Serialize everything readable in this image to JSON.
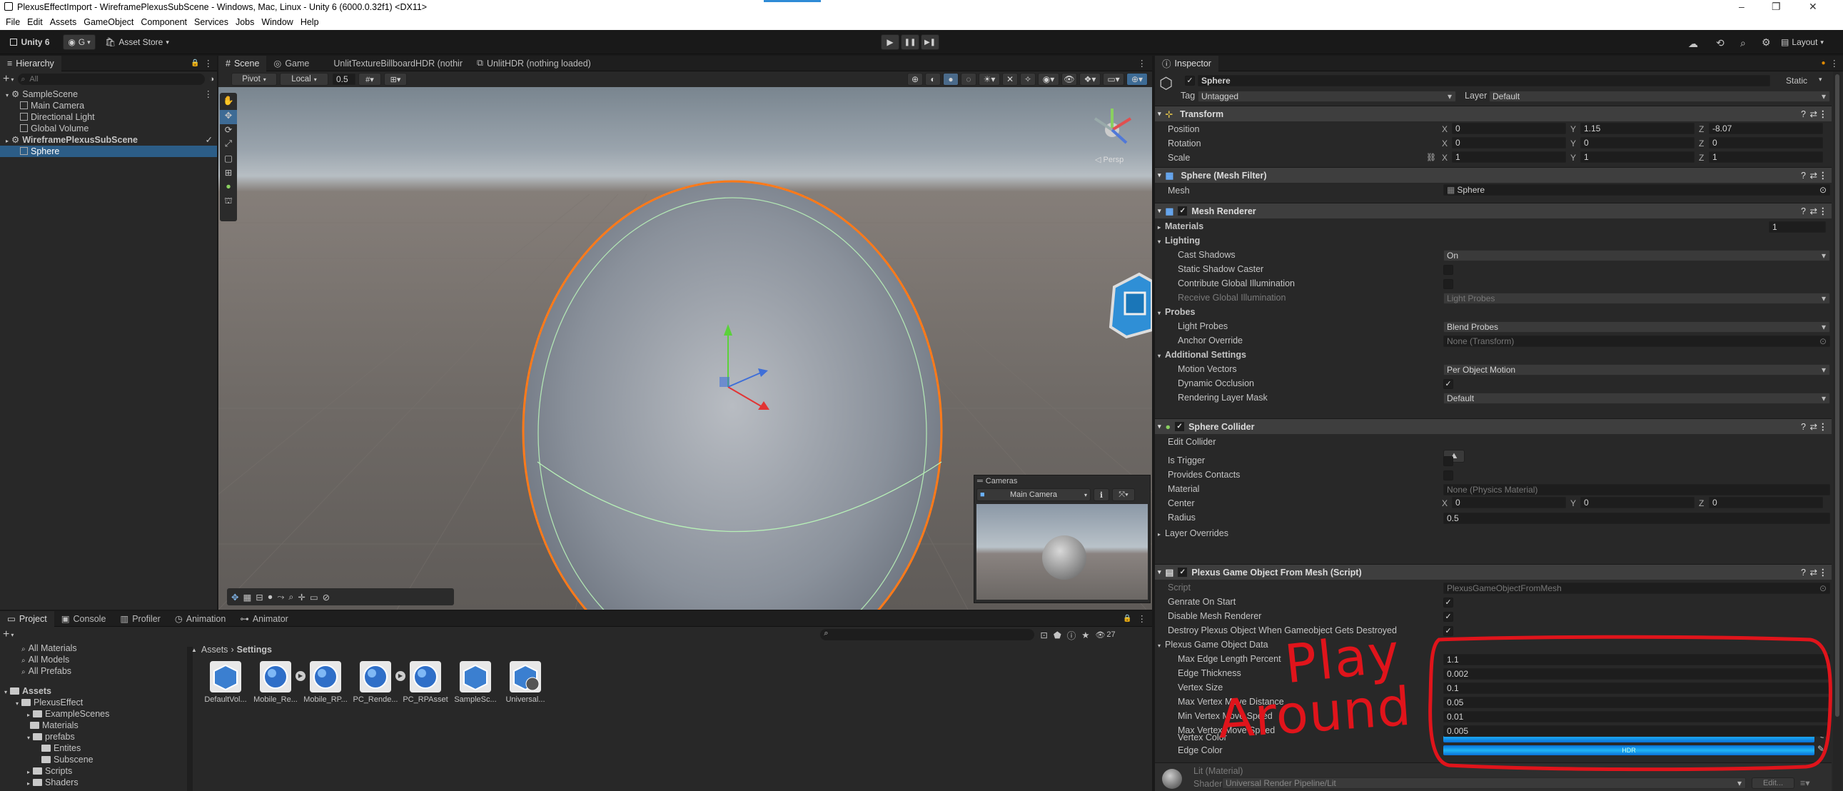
{
  "window": {
    "title": "PlexusEffectImport - WireframePlexusSubScene - Windows, Mac, Linux - Unity 6 (6000.0.32f1) <DX11>",
    "minimize": "–",
    "maximize": "❐",
    "close": "✕"
  },
  "menu": [
    "File",
    "Edit",
    "Assets",
    "GameObject",
    "Component",
    "Services",
    "Jobs",
    "Window",
    "Help"
  ],
  "toolbar": {
    "unity": "Unity 6",
    "account": "G",
    "store": "Asset Store",
    "layout": "Layout"
  },
  "hierarchy": {
    "tab": "Hierarchy",
    "search_placeholder": "All",
    "items": [
      {
        "label": "SampleScene",
        "depth": 0,
        "kind": "scene"
      },
      {
        "label": "Main Camera",
        "depth": 1,
        "kind": "obj"
      },
      {
        "label": "Directional Light",
        "depth": 1,
        "kind": "obj"
      },
      {
        "label": "Global Volume",
        "depth": 1,
        "kind": "obj"
      },
      {
        "label": "WireframePlexusSubScene",
        "depth": 0,
        "kind": "scene",
        "bold": true
      },
      {
        "label": "Sphere",
        "depth": 1,
        "kind": "obj",
        "selected": true
      }
    ]
  },
  "scene": {
    "tabs": [
      "Scene",
      "Game",
      "UnlitTextureBillboardHDR (nothir",
      "UnlitHDR (nothing loaded)"
    ],
    "pivot": "Pivot",
    "local": "Local",
    "snap": "0.5",
    "persp": "◁ Persp",
    "cameras": {
      "title": "Cameras",
      "camera": "Main Camera"
    }
  },
  "project": {
    "tabs": [
      "Project",
      "Console",
      "Profiler",
      "Animation",
      "Animator"
    ],
    "count": "27",
    "favorites": [
      "All Materials",
      "All Models",
      "All Prefabs"
    ],
    "tree": [
      {
        "label": "Assets",
        "depth": 0,
        "bold": true
      },
      {
        "label": "PlexusEffect",
        "depth": 1
      },
      {
        "label": "ExampleScenes",
        "depth": 2
      },
      {
        "label": "Materials",
        "depth": 2
      },
      {
        "label": "prefabs",
        "depth": 2
      },
      {
        "label": "Entites",
        "depth": 3
      },
      {
        "label": "Subscene",
        "depth": 3
      },
      {
        "label": "Scripts",
        "depth": 2
      },
      {
        "label": "Shaders",
        "depth": 2
      }
    ],
    "breadcrumb": [
      "Assets",
      "Settings"
    ],
    "assets": [
      "DefaultVol...",
      "Mobile_Re...",
      "Mobile_RP...",
      "PC_Rende...",
      "PC_RPAsset",
      "SampleSc...",
      "Universal..."
    ]
  },
  "inspector": {
    "tab": "Inspector",
    "name": "Sphere",
    "static": "Static",
    "tag_label": "Tag",
    "tag": "Untagged",
    "layer_label": "Layer",
    "layer": "Default",
    "transform": {
      "title": "Transform",
      "position": [
        "0",
        "1.15",
        "-8.07"
      ],
      "rotation": [
        "0",
        "0",
        "0"
      ],
      "scale": [
        "1",
        "1",
        "1"
      ],
      "labels": [
        "Position",
        "Rotation",
        "Scale"
      ]
    },
    "meshfilter": {
      "title": "Sphere (Mesh Filter)",
      "mesh_label": "Mesh",
      "mesh": "Sphere"
    },
    "meshrenderer": {
      "title": "Mesh Renderer",
      "materials": "Materials",
      "materials_count": "1",
      "lighting": "Lighting",
      "cast_shadows_label": "Cast Shadows",
      "cast_shadows": "On",
      "static_caster": "Static Shadow Caster",
      "contrib_gi": "Contribute Global Illumination",
      "receive_gi_label": "Receive Global Illumination",
      "receive_gi": "Light Probes",
      "probes": "Probes",
      "light_probes_label": "Light Probes",
      "light_probes": "Blend Probes",
      "anchor_label": "Anchor Override",
      "anchor": "None (Transform)",
      "additional": "Additional Settings",
      "motion_label": "Motion Vectors",
      "motion": "Per Object Motion",
      "dyn_occ": "Dynamic Occlusion",
      "layer_mask_label": "Rendering Layer Mask",
      "layer_mask": "Default"
    },
    "collider": {
      "title": "Sphere Collider",
      "edit": "Edit Collider",
      "trigger": "Is Trigger",
      "contacts": "Provides Contacts",
      "material_label": "Material",
      "material": "None (Physics Material)",
      "center_label": "Center",
      "center": [
        "0",
        "0",
        "0"
      ],
      "radius_label": "Radius",
      "radius": "0.5",
      "layer_overrides": "Layer Overrides"
    },
    "plexus": {
      "title": "Plexus Game Object From Mesh (Script)",
      "script_label": "Script",
      "script": "PlexusGameObjectFromMesh",
      "gen_start": "Genrate On Start",
      "disable_mr": "Disable Mesh Renderer",
      "destroy": "Destroy Plexus Object When Gameobject Gets Destroyed",
      "data": "Plexus Game Object Data",
      "fields": [
        {
          "label": "Max Edge Length Percent",
          "value": "1.1"
        },
        {
          "label": "Edge Thickness",
          "value": "0.002"
        },
        {
          "label": "Vertex Size",
          "value": "0.1"
        },
        {
          "label": "Max Vertex Move Distance",
          "value": "0.05"
        },
        {
          "label": "Min Vertex Move Speed",
          "value": "0.01"
        },
        {
          "label": "Max Vertex Move Speed",
          "value": "0.005"
        }
      ],
      "vertex_color": "Vertex Color",
      "edge_color": "Edge Color",
      "hdr": "HDR"
    },
    "material": {
      "name": "Lit (Material)",
      "shader_label": "Shader",
      "shader": "Universal Render Pipeline/Lit",
      "edit": "Edit..."
    }
  },
  "annotation": {
    "line1": "Play",
    "line2": "Around"
  },
  "colors": {
    "accent": "#2c5d87",
    "selection": "#ff7a1a",
    "annotation": "#e0141b",
    "hdr_blue": "#1aa3f0"
  }
}
